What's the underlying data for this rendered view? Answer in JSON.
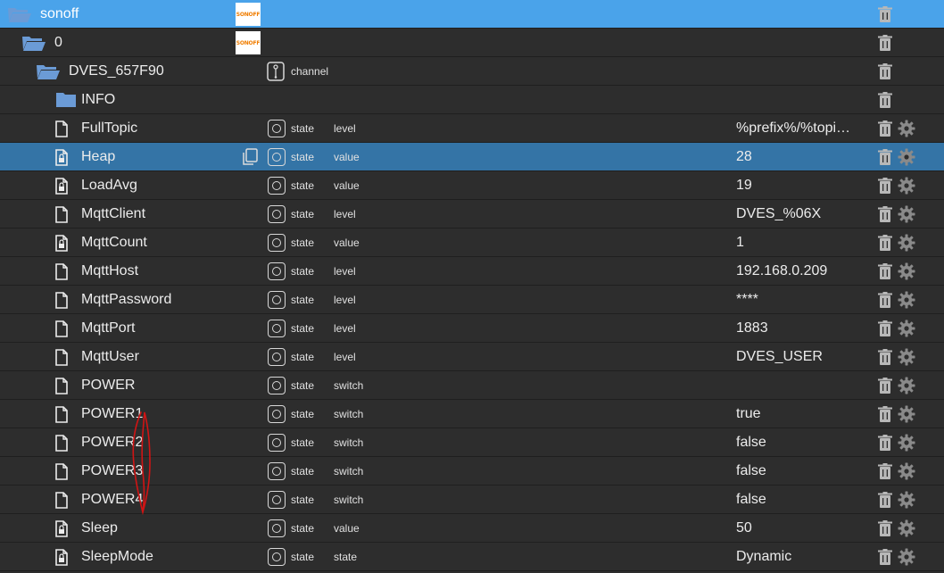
{
  "brand_logo_text": "SONOFF",
  "rows": [
    {
      "name": "sonoff",
      "indent": 0,
      "icon": "folder-open-icon",
      "logo": true,
      "selected_top": true
    },
    {
      "name": "0",
      "indent": 1,
      "icon": "folder-open-icon",
      "logo": true
    },
    {
      "name": "DVES_657F90",
      "indent": 2,
      "icon": "folder-open-icon",
      "type_icon": "channel-icon",
      "type": "channel"
    },
    {
      "name": "INFO",
      "indent": 3,
      "icon": "folder-closed-icon"
    },
    {
      "name": "FullTopic",
      "indent": 3,
      "icon": "file-icon",
      "type_icon": "state-icon",
      "type": "state",
      "role": "level",
      "value": "%prefix%/%topi…",
      "gear": true
    },
    {
      "name": "Heap",
      "indent": 3,
      "icon": "file-lock-icon",
      "type_icon": "state-icon",
      "type": "state",
      "role": "value",
      "value": "28",
      "gear": true,
      "selected": true,
      "copy": true
    },
    {
      "name": "LoadAvg",
      "indent": 3,
      "icon": "file-lock-icon",
      "type_icon": "state-icon",
      "type": "state",
      "role": "value",
      "value": "19",
      "gear": true
    },
    {
      "name": "MqttClient",
      "indent": 3,
      "icon": "file-icon",
      "type_icon": "state-icon",
      "type": "state",
      "role": "level",
      "value": "DVES_%06X",
      "gear": true
    },
    {
      "name": "MqttCount",
      "indent": 3,
      "icon": "file-lock-icon",
      "type_icon": "state-icon",
      "type": "state",
      "role": "value",
      "value": "1",
      "gear": true
    },
    {
      "name": "MqttHost",
      "indent": 3,
      "icon": "file-icon",
      "type_icon": "state-icon",
      "type": "state",
      "role": "level",
      "value": "192.168.0.209",
      "gear": true
    },
    {
      "name": "MqttPassword",
      "indent": 3,
      "icon": "file-icon",
      "type_icon": "state-icon",
      "type": "state",
      "role": "level",
      "value": "****",
      "gear": true
    },
    {
      "name": "MqttPort",
      "indent": 3,
      "icon": "file-icon",
      "type_icon": "state-icon",
      "type": "state",
      "role": "level",
      "value": "1883",
      "gear": true
    },
    {
      "name": "MqttUser",
      "indent": 3,
      "icon": "file-icon",
      "type_icon": "state-icon",
      "type": "state",
      "role": "level",
      "value": "DVES_USER",
      "gear": true
    },
    {
      "name": "POWER",
      "indent": 3,
      "icon": "file-icon",
      "type_icon": "state-icon",
      "type": "state",
      "role": "switch",
      "value": "",
      "gear": true
    },
    {
      "name": "POWER1",
      "indent": 3,
      "icon": "file-icon",
      "type_icon": "state-icon",
      "type": "state",
      "role": "switch",
      "value": "true",
      "gear": true
    },
    {
      "name": "POWER2",
      "indent": 3,
      "icon": "file-icon",
      "type_icon": "state-icon",
      "type": "state",
      "role": "switch",
      "value": "false",
      "gear": true
    },
    {
      "name": "POWER3",
      "indent": 3,
      "icon": "file-icon",
      "type_icon": "state-icon",
      "type": "state",
      "role": "switch",
      "value": "false",
      "gear": true
    },
    {
      "name": "POWER4",
      "indent": 3,
      "icon": "file-icon",
      "type_icon": "state-icon",
      "type": "state",
      "role": "switch",
      "value": "false",
      "gear": true
    },
    {
      "name": "Sleep",
      "indent": 3,
      "icon": "file-lock-icon",
      "type_icon": "state-icon",
      "type": "state",
      "role": "value",
      "value": "50",
      "gear": true
    },
    {
      "name": "SleepMode",
      "indent": 3,
      "icon": "file-lock-icon",
      "type_icon": "state-icon",
      "type": "state",
      "role": "state",
      "value": "Dynamic",
      "gear": true
    }
  ],
  "colors": {
    "background": "#2d2d2d",
    "selected_top": "#4aa3ea",
    "selected": "#3474a6",
    "folder": "#6b9bd6",
    "annotation": "#d01414"
  }
}
